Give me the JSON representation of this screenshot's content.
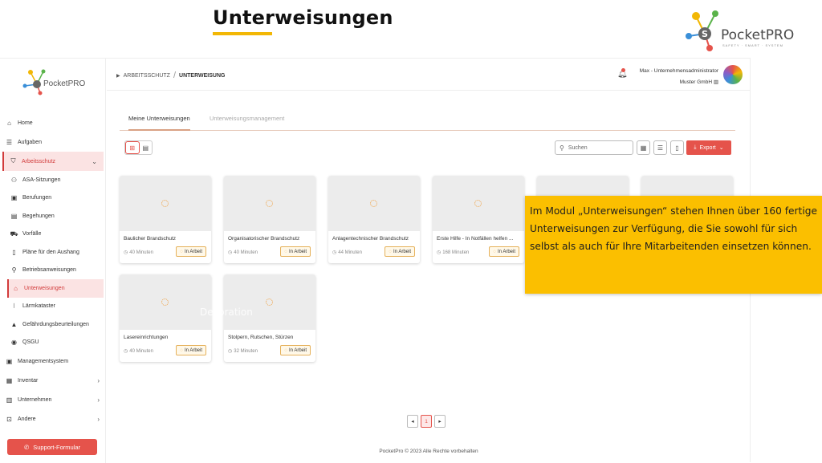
{
  "slide": {
    "title": "Unterweisungen",
    "accent": "#f2b705"
  },
  "brand": {
    "name": "PocketPRO",
    "tagline": "SAFETY · SMART · SYSTEM"
  },
  "sidebar": {
    "logo": "PocketPRO",
    "items": [
      {
        "label": "Home",
        "icon": "home-icon"
      },
      {
        "label": "Aufgaben",
        "icon": "list-icon"
      },
      {
        "label": "Arbeitsschutz",
        "icon": "shield-icon"
      },
      {
        "label": "ASA-Sitzungen",
        "icon": "people-icon"
      },
      {
        "label": "Berufungen",
        "icon": "id-badge-icon"
      },
      {
        "label": "Begehungen",
        "icon": "clipboard-icon"
      },
      {
        "label": "Vorfälle",
        "icon": "ambulance-icon"
      },
      {
        "label": "Pläne für den Aushang",
        "icon": "document-icon"
      },
      {
        "label": "Betriebsanweisungen",
        "icon": "user-instruction-icon"
      },
      {
        "label": "Unterweisungen",
        "icon": "graduation-cap-icon"
      },
      {
        "label": "Lärmkataster",
        "icon": "sound-wave-icon"
      },
      {
        "label": "Gefährdungsbeurteilungen",
        "icon": "warning-icon"
      },
      {
        "label": "QSGU",
        "icon": "qsgu-icon"
      },
      {
        "label": "Managementsystem",
        "icon": "management-icon"
      },
      {
        "label": "Inventar",
        "icon": "inventory-icon"
      },
      {
        "label": "Unternehmen",
        "icon": "building-icon"
      },
      {
        "label": "Andere",
        "icon": "other-icon"
      }
    ],
    "support_label": "Support-Formular"
  },
  "topbar": {
    "breadcrumb_parent": "ARBEITSSCHUTZ",
    "breadcrumb_sep": "/",
    "breadcrumb_current": "UNTERWEISUNG",
    "user_name": "Max - Unternehmensadministrator",
    "company": "Muster GmbH"
  },
  "tabs": {
    "active": "Meine Unterweisungen",
    "inactive": "Unterweisungsmanagement"
  },
  "toolbar": {
    "search_placeholder": "Suchen",
    "export_label": "Export"
  },
  "cards": [
    {
      "title": "Baulicher Brandschutz",
      "duration": "40 Minuten",
      "status": "In Arbeit"
    },
    {
      "title": "Organisatorischer Brandschutz",
      "duration": "40 Minuten",
      "status": "In Arbeit"
    },
    {
      "title": "Anlagentechnischer Brandschutz",
      "duration": "44 Minuten",
      "status": "In Arbeit"
    },
    {
      "title": "Erste Hilfe - In Notfällen helfen ...",
      "duration": "168 Minuten",
      "status": "In Arbeit"
    },
    {
      "title": "",
      "duration": "",
      "status": ""
    },
    {
      "title": "",
      "duration": "",
      "status": ""
    },
    {
      "title": "Lasereinrichtungen",
      "duration": "40 Minuten",
      "status": "In Arbeit"
    },
    {
      "title": "Stolpern, Rutschen, Stürzen",
      "duration": "32 Minuten",
      "status": "In Arbeit"
    }
  ],
  "watermark": "Decoration",
  "pagination": {
    "current": "1"
  },
  "footer": "PocketPro © 2023 Alle Rechte vorbehalten",
  "callout": {
    "text": "Im Modul „Unterweisungen“ stehen Ihnen über 160 fertige Unterweisungen zur Verfügung, die Sie sowohl für sich selbst als auch für Ihre Mitarbeitenden einsetzen können."
  }
}
